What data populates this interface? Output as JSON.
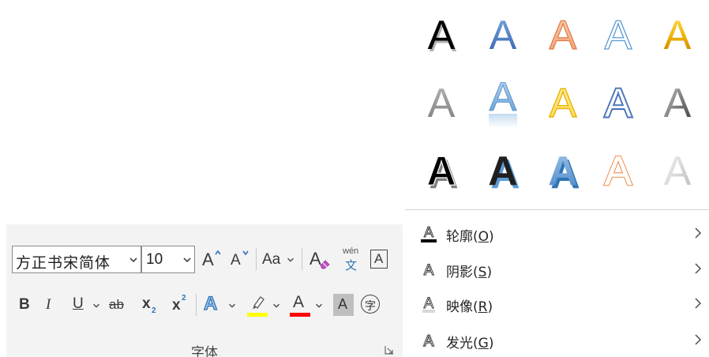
{
  "font_group": {
    "font_name": "方正书宋简体",
    "font_size": "10",
    "grow_label": "A",
    "shrink_label": "A",
    "case_label": "Aa",
    "clear_label": "A",
    "phonetic_top": "wén",
    "phonetic_bottom": "文",
    "border_label": "A",
    "bold_label": "B",
    "italic_label": "I",
    "underline_label": "U",
    "strike_label": "ab",
    "subscript_label": "x",
    "subscript_mark": "2",
    "superscript_label": "x",
    "superscript_mark": "2",
    "effects_label": "A",
    "font_color_label": "A",
    "shading_label": "A",
    "enclose_label": "字",
    "group_title": "字体",
    "highlight_color": "#ffff00",
    "font_color": "#ff0000",
    "accent_blue": "#2e75b6"
  },
  "gallery": {
    "letter": "A",
    "styles": [
      "black-shadow",
      "blue-gradient",
      "orange-outline-fill",
      "white-blue-outline",
      "gold-gradient",
      "gray-gradient",
      "blue-reflection",
      "gold-outline",
      "blue-double-outline",
      "gray-bevel",
      "black-3d-white",
      "black-3d-blue",
      "blue-3d",
      "orange-outline-white",
      "silver-fade"
    ]
  },
  "menu": [
    {
      "icon": "outline-icon",
      "label": "轮廓(",
      "accel": "O",
      "suffix": ")"
    },
    {
      "icon": "shadow-icon",
      "label": "阴影(",
      "accel": "S",
      "suffix": ")"
    },
    {
      "icon": "reflection-icon",
      "label": "映像(",
      "accel": "R",
      "suffix": ")"
    },
    {
      "icon": "glow-icon",
      "label": "发光(",
      "accel": "G",
      "suffix": ")"
    }
  ]
}
